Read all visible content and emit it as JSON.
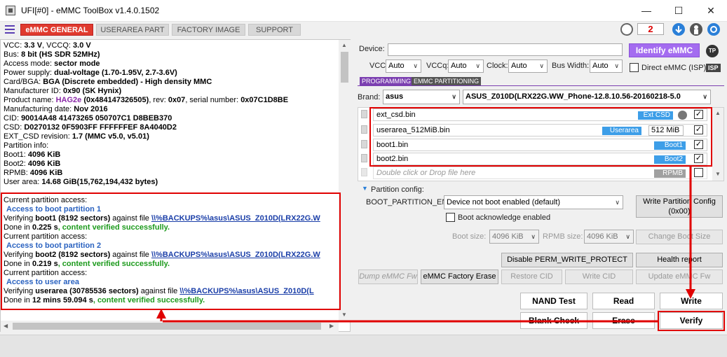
{
  "window": {
    "title": "UFI[#0] - eMMC ToolBox v1.4.0.1502",
    "minimize_glyph": "—",
    "maximize_glyph": "☐",
    "close_glyph": "✕"
  },
  "tabs": [
    "eMMC GENERAL",
    "USERAREA PART",
    "FACTORY IMAGE",
    "SUPPORT"
  ],
  "toolbar": {
    "badge_count": "2"
  },
  "log": {
    "info": [
      {
        "pre": "VCC: ",
        "b": "3.3 V",
        "mid": ", VCCQ: ",
        "b2": "3.0 V"
      },
      {
        "pre": "Bus: ",
        "b": "8 bit (HS SDR 52MHz)"
      },
      {
        "pre": "Access mode: ",
        "b": "sector mode"
      },
      {
        "pre": "Power supply: ",
        "b": "dual-voltage (1.70-1.95V, 2.7-3.6V)"
      },
      {
        "pre": " Card/BGA: ",
        "b": "BGA (Discrete embedded) - High density MMC"
      },
      {
        "pre": " Manufacturer ID: ",
        "b": "0x90 (SK Hynix)"
      },
      {
        "pre": " Product name: ",
        "p": "HAG2e",
        "b": " (0x484147326505)",
        "mid": ", rev: ",
        "b2": "0x07",
        "mid2": ", serial number: ",
        "b3": "0x07C1D8BE"
      },
      {
        "pre": " Manufacturing date: ",
        "b": "Nov 2016"
      },
      {
        "pre": "CID: ",
        "b": "90014A48 41473265 050707C1 D8BEB370"
      },
      {
        "pre": "CSD: ",
        "b": "D0270132 0F5903FF FFFFFFEF 8A4040D2"
      },
      {
        "pre": "EXT_CSD revision: ",
        "b": "1.7 (MMC v5.0, v5.01)"
      },
      {
        "pre": "Partition info:"
      },
      {
        "pre": " Boot1: ",
        "b": "4096 KiB"
      },
      {
        "pre": " Boot2: ",
        "b": "4096 KiB"
      },
      {
        "pre": " RPMB: ",
        "b": "4096 KiB"
      },
      {
        "pre": " User area: ",
        "b": "14.68 GiB(15,762,194,432 bytes)"
      }
    ],
    "verify": {
      "access_header": "Current partition access:",
      "boot1_heading": "Access to boot partition 1",
      "boot1_verify_pre": "Verifying ",
      "boot1_verify_b": "boot1 (8192 sectors)",
      "boot1_verify_mid": " against file ",
      "boot1_file": "\\\\%BACKUPS%\\asus\\ASUS_Z010D(LRX22G.W",
      "boot1_done_pre": "Done in ",
      "boot1_time": "0.225 s",
      "ok": ", content verified successfully.",
      "boot2_heading": "Access to boot partition 2",
      "boot2_verify_b": "boot2 (8192 sectors)",
      "boot2_file": "\\\\%BACKUPS%\\asus\\ASUS_Z010D(LRX22G.W",
      "boot2_time": "0.219 s",
      "user_heading": "Access to user area",
      "user_verify_b": "userarea (30785536 sectors)",
      "user_file": "\\\\%BACKUPS%\\asus\\ASUS_Z010D(L",
      "user_time": "12 mins 59.094 s"
    }
  },
  "device": {
    "label": "Device:",
    "value": "",
    "identify": "Identify eMMC",
    "tp": "TP",
    "vcc_label": "VCC:",
    "vcc": "Auto",
    "vccq_label": "VCCq:",
    "vccq": "Auto",
    "clock_label": "Clock:",
    "clock": "Auto",
    "bus_label": "Bus Width:",
    "bus": "Auto",
    "direct_label": "Direct eMMC (ISP)",
    "isp": "ISP"
  },
  "subtabs": [
    "PROGRAMMING",
    "EMMC PARTITIONING"
  ],
  "brand": {
    "label": "Brand:",
    "value": "asus",
    "firmware": "ASUS_Z010D(LRX22G.WW_Phone-12.8.10.56-20160218-5.0"
  },
  "partitions": [
    {
      "name": "ext_csd.bin",
      "tag": "Ext CSD",
      "checked": "✓"
    },
    {
      "name": "userarea_512MiB.bin",
      "tag": "Userarea",
      "size": "512 MiB",
      "checked": "✓"
    },
    {
      "name": "boot1.bin",
      "tag": "Boot1",
      "checked": "✓"
    },
    {
      "name": "boot2.bin",
      "tag": "Boot2",
      "checked": "✓"
    },
    {
      "name": "Double click or Drop file here",
      "tag": "RPMB",
      "checked": ""
    }
  ],
  "partition_config": {
    "header": "Partition config:",
    "boot_label": "BOOT_PARTITION_EN",
    "boot_value": "Device not boot enabled (default)",
    "write_btn": "Write Partition Config (0x00)",
    "ack_label": "Boot acknowledge enabled",
    "boot_size_label": "Boot size:",
    "boot_size": "4096 KiB",
    "rpmb_size_label": "RPMB size:",
    "rpmb_size": "4096 KiB",
    "change_boot_size": "Change Boot Size"
  },
  "buttons": {
    "disable_wp": "Disable PERM_WRITE_PROTECT",
    "health": "Health report",
    "dump_fw": "Dump eMMC Fw",
    "factory_erase": "eMMC Factory Erase",
    "restore_cid": "Restore CID",
    "write_cid": "Write CID",
    "update_fw": "Update eMMC Fw",
    "nand_test": "NAND Test",
    "read": "Read",
    "write": "Write",
    "blank_check": "Blank Check",
    "erase": "Erase",
    "verify": "Verify"
  },
  "colors": {
    "tab_active": "#e03a2e",
    "identify": "#a46cf0",
    "highlight": "#e00000",
    "success": "#1c9a1c",
    "link": "#1a3ea8"
  }
}
